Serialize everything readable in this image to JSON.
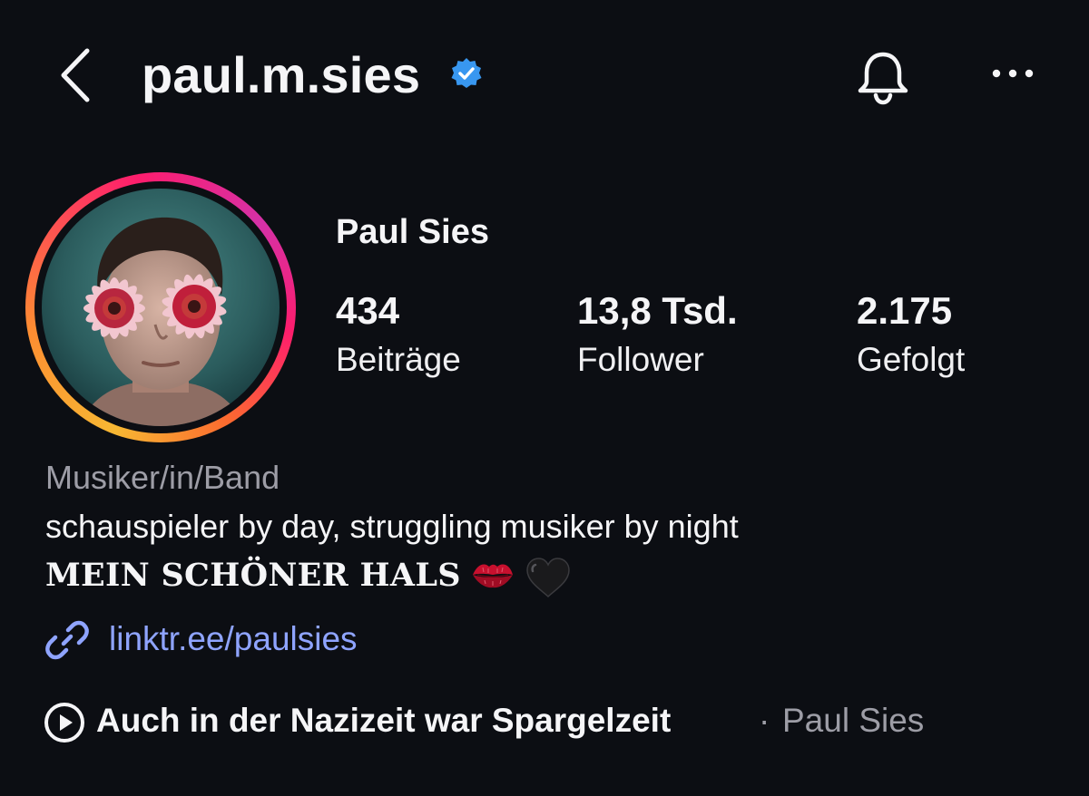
{
  "header": {
    "username": "paul.m.sies",
    "verified": true,
    "back_icon": "chevron-left-icon",
    "bell_icon": "bell-icon",
    "more_icon": "more-horizontal-icon"
  },
  "profile": {
    "display_name": "Paul Sies",
    "avatar": "profile-photo-flowers-over-eyes",
    "stats": [
      {
        "value": "434",
        "label": "Beiträge"
      },
      {
        "value": "13,8 Tsd.",
        "label": "Follower"
      },
      {
        "value": "2.175",
        "label": "Gefolgt"
      }
    ]
  },
  "bio": {
    "category": "Musiker/in/Band",
    "line1": "schauspieler by day, struggling musiker by night",
    "line2": "MEIN SCHÖNER HALS",
    "line2_emojis": [
      "kiss-mark-icon",
      "black-heart-icon"
    ],
    "link": "linktr.ee/paulsies"
  },
  "audio": {
    "title": "Auch in der Nazizeit war Spargelzeit",
    "separator": "·",
    "artist": "Paul Sies"
  },
  "colors": {
    "background": "#0c0e13",
    "text": "#f5f5f7",
    "secondary_text": "#9d9da6",
    "link": "#8fa4ff",
    "verified": "#3897f0",
    "story_ring": [
      "#f7b733",
      "#fd1d6d",
      "#d531a7"
    ]
  }
}
